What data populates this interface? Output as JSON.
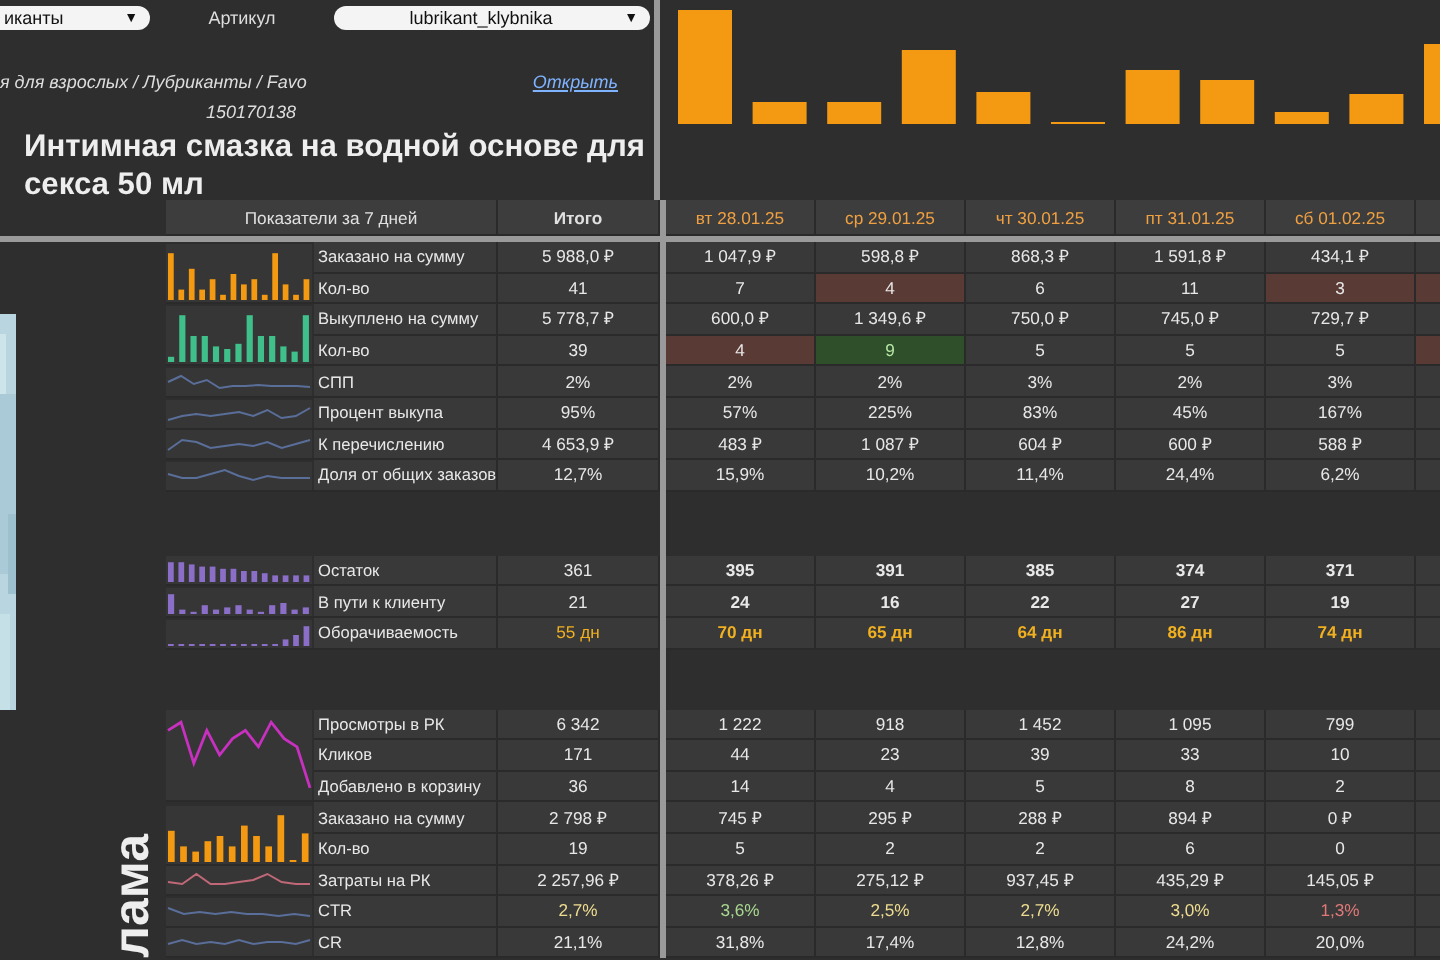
{
  "filters": {
    "category_dropdown": {
      "value": "иканты",
      "caret": "▼"
    },
    "article_label": "Артикул",
    "article_dropdown": {
      "value": "lubrikant_klybnika",
      "caret": "▼"
    }
  },
  "product": {
    "breadcrumb": "я для взрослых / Лубриканты / Favo",
    "open_link": "Открыть",
    "article_id": "150170138",
    "title": "Интимная смазка на водной основе для секса 50 мл"
  },
  "table": {
    "metrics_header": "Показатели за 7 дней",
    "total_header": "Итого",
    "dates": [
      "вт 28.01.25",
      "ср 29.01.25",
      "чт 30.01.25",
      "пт 31.01.25",
      "сб 01.02.25"
    ]
  },
  "side_label": "лама",
  "sections": [
    {
      "bold_days": false,
      "rows": [
        {
          "label": "Заказано на сумму",
          "total": "5 988,0 ₽",
          "values": [
            "1 047,9 ₽",
            "598,8 ₽",
            "868,3 ₽",
            "1 591,8 ₽",
            "434,1 ₽"
          ]
        },
        {
          "label": "Кол-во",
          "total": "41",
          "values": [
            {
              "value": "7",
              "low": false,
              "high": false
            },
            {
              "value": "4",
              "low": true,
              "high": false
            },
            {
              "value": "6",
              "low": false,
              "high": false
            },
            {
              "value": "11",
              "low": false,
              "high": false
            },
            {
              "value": "3",
              "low": true,
              "high": false
            }
          ]
        },
        {
          "label": "Выкуплено на сумму",
          "total": "5 778,7 ₽",
          "values": [
            "600,0 ₽",
            "1 349,6 ₽",
            "750,0 ₽",
            "745,0 ₽",
            "729,7 ₽"
          ]
        },
        {
          "label": "Кол-во",
          "total": "39",
          "values": [
            {
              "value": "4",
              "low": true,
              "high": false
            },
            {
              "value": "9",
              "low": false,
              "high": true
            },
            {
              "value": "5",
              "low": false,
              "high": false
            },
            {
              "value": "5",
              "low": false,
              "high": false
            },
            {
              "value": "5",
              "low": false,
              "high": false
            }
          ]
        },
        {
          "label": "СПП",
          "total": "2%",
          "values": [
            "2%",
            "2%",
            "3%",
            "2%",
            "3%"
          ]
        },
        {
          "label": "Процент выкупа",
          "total": "95%",
          "values": [
            "57%",
            "225%",
            "83%",
            "45%",
            "167%"
          ]
        },
        {
          "label": "К перечислению",
          "total": "4 653,9 ₽",
          "values": [
            "483 ₽",
            "1 087 ₽",
            "604 ₽",
            "600 ₽",
            "588 ₽"
          ]
        },
        {
          "label": "Доля от общих заказов",
          "total": "12,7%",
          "values": [
            "15,9%",
            "10,2%",
            "11,4%",
            "24,4%",
            "6,2%"
          ]
        }
      ]
    },
    {
      "bold_days": true,
      "rows": [
        {
          "label": "Остаток",
          "total": "361",
          "values": [
            "395",
            "391",
            "385",
            "374",
            "371"
          ]
        },
        {
          "label": "В пути к клиенту",
          "total": "21",
          "values": [
            "24",
            "16",
            "22",
            "27",
            "19"
          ]
        },
        {
          "label": "Оборачиваемость",
          "total": {
            "value": "55 дн",
            "color": "#f0b020"
          },
          "values": [
            {
              "value": "70 дн",
              "color": "#f0b020"
            },
            {
              "value": "65 дн",
              "color": "#f0b020"
            },
            {
              "value": "64 дн",
              "color": "#f0b020"
            },
            {
              "value": "86 дн",
              "color": "#f0b020"
            },
            {
              "value": "74 дн",
              "color": "#f0b020"
            }
          ]
        }
      ]
    },
    {
      "bold_days": false,
      "rows": [
        {
          "label": "Просмотры в РК",
          "total": "6 342",
          "values": [
            "1 222",
            "918",
            "1 452",
            "1 095",
            "799"
          ]
        },
        {
          "label": "Кликов",
          "total": "171",
          "values": [
            "44",
            "23",
            "39",
            "33",
            "10"
          ]
        },
        {
          "label": "Добавлено в корзину",
          "total": "36",
          "values": [
            "14",
            "4",
            "5",
            "8",
            "2"
          ]
        },
        {
          "label": "Заказано на сумму",
          "total": "2 798 ₽",
          "values": [
            "745 ₽",
            "295 ₽",
            "288 ₽",
            "894 ₽",
            "0 ₽"
          ]
        },
        {
          "label": "Кол-во",
          "total": "19",
          "values": [
            "5",
            "2",
            "2",
            "6",
            "0"
          ]
        },
        {
          "label": "Затраты на РК",
          "total": "2 257,96 ₽",
          "values": [
            "378,26 ₽",
            "275,12 ₽",
            "937,45 ₽",
            "435,29 ₽",
            "145,05 ₽"
          ]
        },
        {
          "label": "CTR",
          "total": {
            "value": "2,7%",
            "color": "#eedd90"
          },
          "values": [
            {
              "value": "3,6%",
              "color": "#a8d890"
            },
            {
              "value": "2,5%",
              "color": "#eedd90"
            },
            {
              "value": "2,7%",
              "color": "#eedd90"
            },
            {
              "value": "3,0%",
              "color": "#eedd90"
            },
            {
              "value": "1,3%",
              "color": "#e07878"
            }
          ]
        },
        {
          "label": "CR",
          "total": "21,1%",
          "values": [
            "31,8%",
            "17,4%",
            "12,8%",
            "24,2%",
            "20,0%"
          ]
        }
      ]
    }
  ]
}
